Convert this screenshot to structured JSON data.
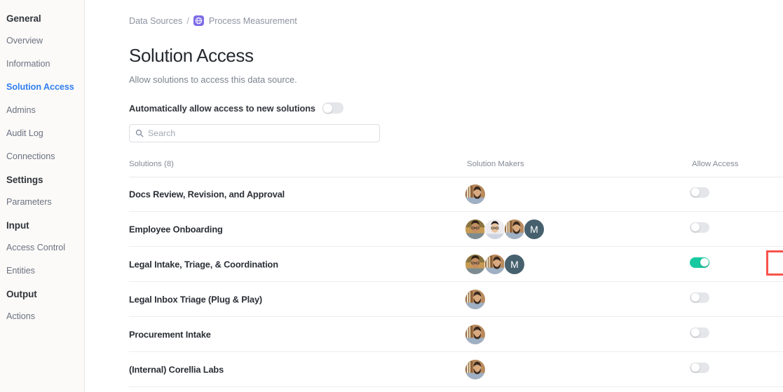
{
  "sidebar": {
    "groups": [
      {
        "header": "General",
        "items": [
          {
            "label": "Overview",
            "active": false
          },
          {
            "label": "Information",
            "active": false
          },
          {
            "label": "Solution Access",
            "active": true
          },
          {
            "label": "Admins",
            "active": false
          },
          {
            "label": "Audit Log",
            "active": false
          },
          {
            "label": "Connections",
            "active": false
          }
        ]
      },
      {
        "header": "Settings",
        "items": [
          {
            "label": "Parameters",
            "active": false
          }
        ]
      },
      {
        "header": "Input",
        "items": [
          {
            "label": "Access Control",
            "active": false
          },
          {
            "label": "Entities",
            "active": false
          }
        ]
      },
      {
        "header": "Output",
        "items": [
          {
            "label": "Actions",
            "active": false
          }
        ]
      }
    ]
  },
  "breadcrumb": {
    "root": "Data Sources",
    "separator": "/",
    "icon": "globe-icon",
    "current": "Process Measurement",
    "icon_color": "#7b6ce8"
  },
  "page": {
    "title": "Solution Access",
    "subtitle": "Allow solutions to access this data source."
  },
  "auto_allow": {
    "label": "Automatically allow access to new solutions",
    "enabled": false
  },
  "search": {
    "placeholder": "Search",
    "value": "",
    "icon": "search-icon"
  },
  "table": {
    "columns": {
      "solutions": "Solutions (8)",
      "makers": "Solution Makers",
      "access": "Allow Access"
    },
    "rows": [
      {
        "name": "Docs Review, Revision, and Approval",
        "makers": [
          {
            "type": "photo",
            "tone": "beard"
          }
        ],
        "access": false,
        "highlighted": false
      },
      {
        "name": "Employee Onboarding",
        "makers": [
          {
            "type": "photo",
            "tone": "glasses-warm"
          },
          {
            "type": "photo",
            "tone": "glasses-light"
          },
          {
            "type": "photo",
            "tone": "beard"
          },
          {
            "type": "initial",
            "label": "M"
          }
        ],
        "access": false,
        "highlighted": false
      },
      {
        "name": "Legal Intake, Triage, & Coordination",
        "makers": [
          {
            "type": "photo",
            "tone": "glasses-warm"
          },
          {
            "type": "photo",
            "tone": "beard"
          },
          {
            "type": "initial",
            "label": "M"
          }
        ],
        "access": true,
        "highlighted": true
      },
      {
        "name": "Legal Inbox Triage (Plug & Play)",
        "makers": [
          {
            "type": "photo",
            "tone": "beard"
          }
        ],
        "access": false,
        "highlighted": false
      },
      {
        "name": "Procurement Intake",
        "makers": [
          {
            "type": "photo",
            "tone": "beard"
          }
        ],
        "access": false,
        "highlighted": false
      },
      {
        "name": "(Internal) Corellia Labs",
        "makers": [
          {
            "type": "photo",
            "tone": "beard"
          }
        ],
        "access": false,
        "highlighted": false
      }
    ]
  },
  "colors": {
    "accent_blue": "#2f7ef0",
    "toggle_on": "#17c9a0",
    "toggle_off": "#e4e6ea",
    "highlight_red": "#f8534a",
    "avatar_initial_bg": "#46606e"
  }
}
